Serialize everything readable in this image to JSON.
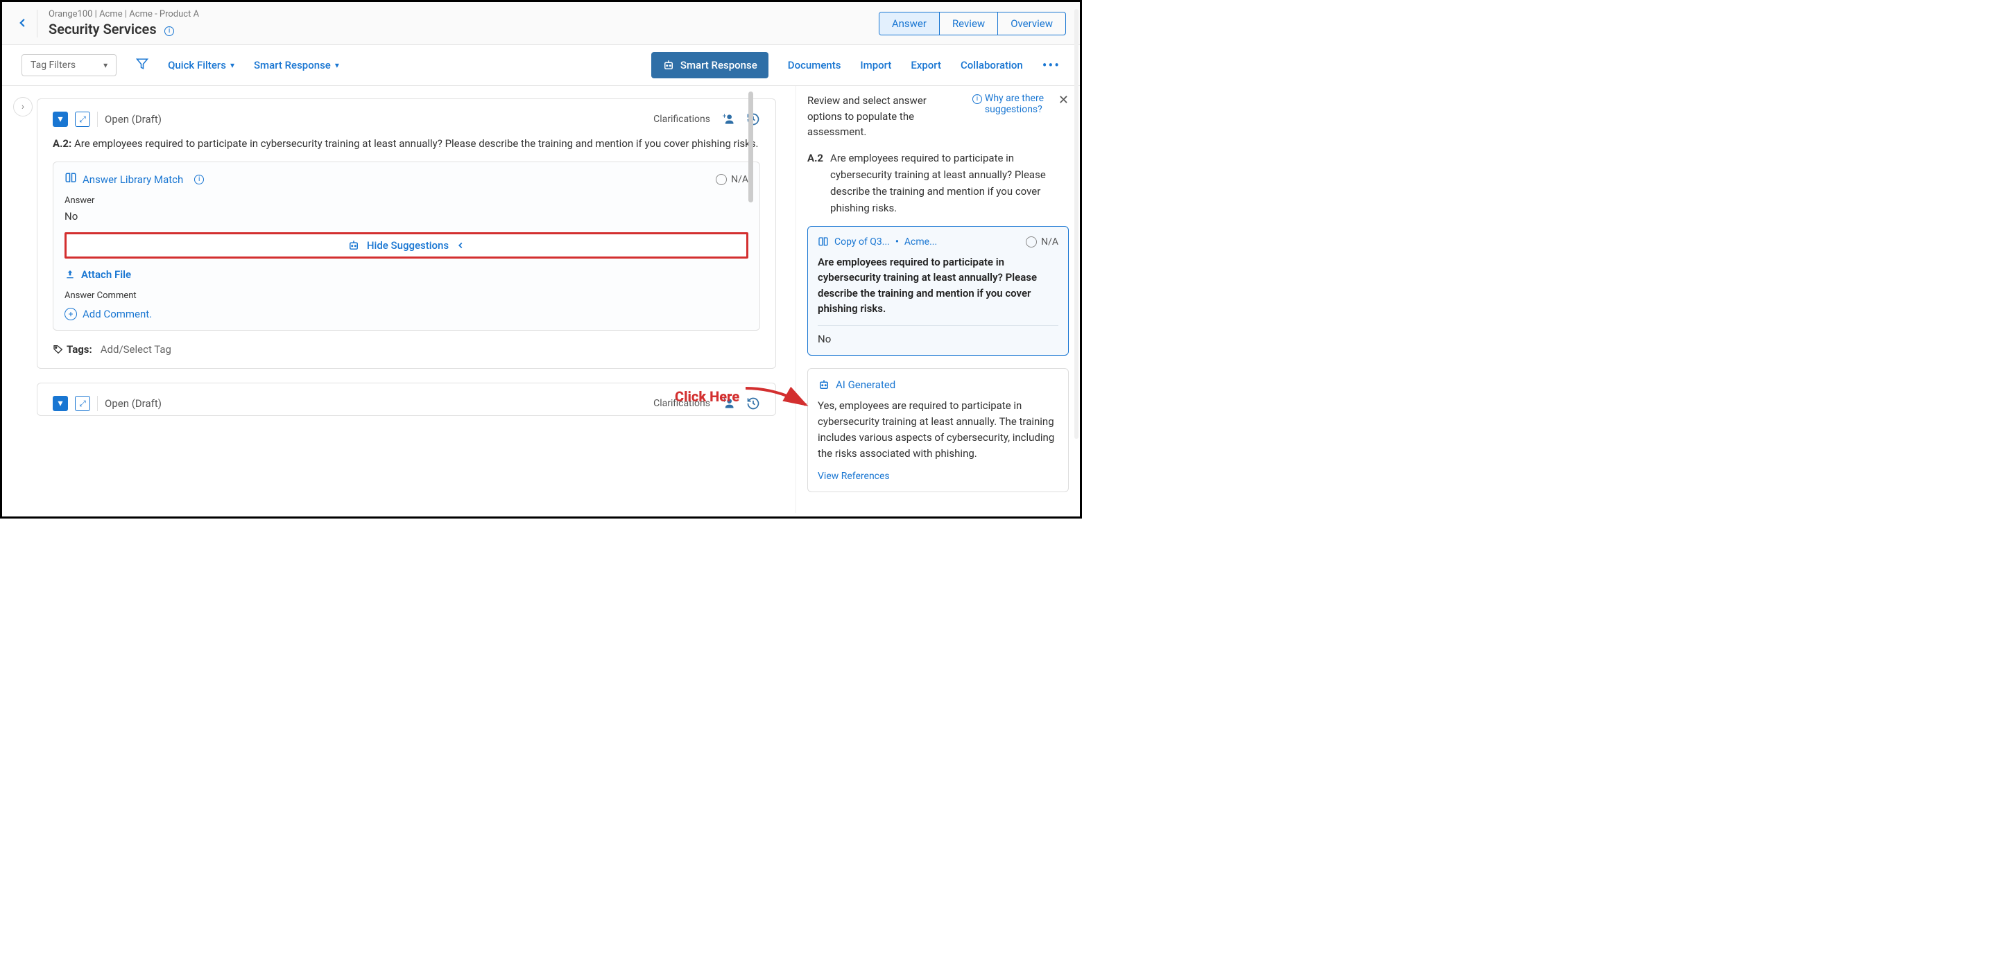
{
  "header": {
    "breadcrumb": "Orange100 | Acme | Acme - Product A",
    "title": "Security Services"
  },
  "tabs": {
    "answer": "Answer",
    "review": "Review",
    "overview": "Overview"
  },
  "toolbar": {
    "tag_filters": "Tag Filters",
    "quick_filters": "Quick Filters",
    "smart_response_dd": "Smart Response",
    "smart_response_btn": "Smart Response",
    "documents": "Documents",
    "import": "Import",
    "export": "Export",
    "collaboration": "Collaboration"
  },
  "question": {
    "status": "Open (Draft)",
    "clarifications": "Clarifications",
    "id": "A.2:",
    "text": "Are employees required to participate in cybersecurity training at least annually? Please describe the training and mention if you cover phishing risks.",
    "library_match": "Answer Library Match",
    "na": "N/A",
    "answer_label": "Answer",
    "answer_value": "No",
    "hide_suggestions": "Hide Suggestions",
    "attach_file": "Attach File",
    "answer_comment": "Answer Comment",
    "add_comment": "Add Comment.",
    "tags_label": "Tags:",
    "tags_placeholder": "Add/Select Tag"
  },
  "question2": {
    "status": "Open (Draft)",
    "clarifications": "Clarifications"
  },
  "right": {
    "review_text": "Review and select answer options to populate the assessment.",
    "why_link": "Why are there suggestions?",
    "q_id": "A.2",
    "q_text": "Are employees required to participate in cybersecurity training at least annually? Please describe the training and mention if you cover phishing risks.",
    "sugg": {
      "copy": "Copy of Q3...",
      "acme": "Acme...",
      "na": "N/A",
      "q": "Are employees required to participate in cybersecurity training at least annually? Please describe the training and mention if you cover phishing risks.",
      "ans": "No"
    },
    "ai": {
      "label": "AI Generated",
      "text": "Yes, employees are required to participate in cybersecurity training at least annually. The training includes various aspects of cybersecurity, including the risks associated with phishing.",
      "view_ref": "View References"
    }
  },
  "callout": "Click Here"
}
